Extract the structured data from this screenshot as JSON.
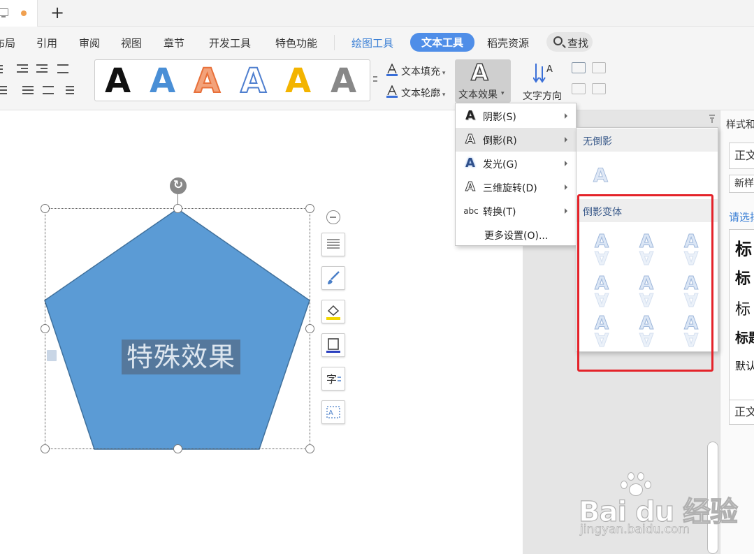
{
  "tabbar": {
    "new_tab": "+"
  },
  "menu": {
    "items": [
      "布局",
      "引用",
      "审阅",
      "视图",
      "章节",
      "开发工具",
      "特色功能"
    ],
    "drawing_tools": "绘图工具",
    "text_tools": "文本工具",
    "resources": "稻壳资源",
    "search": "查找"
  },
  "toolbar": {
    "style_glyph": "A",
    "text_fill": "文本填充",
    "text_outline": "文本轮廓",
    "text_effects": "文本效果",
    "text_direction": "文字方向",
    "gallery_colors": [
      "#111111",
      "#4a8fd6",
      "#f08c52",
      "#4f7fcf",
      "#f3b400",
      "#777777"
    ]
  },
  "effects_menu": {
    "items": [
      {
        "label": "阴影(S)",
        "icon": "shadow-a-icon",
        "has_sub": true
      },
      {
        "label": "倒影(R)",
        "icon": "reflection-a-icon",
        "has_sub": true
      },
      {
        "label": "发光(G)",
        "icon": "glow-a-icon",
        "has_sub": true
      },
      {
        "label": "三维旋转(D)",
        "icon": "3d-rotation-a-icon",
        "has_sub": true
      },
      {
        "label": "转换(T)",
        "icon": "abc-transform-icon",
        "has_sub": true
      },
      {
        "label": "更多设置(O)...",
        "icon": "",
        "has_sub": false
      }
    ],
    "abc": "abc"
  },
  "reflection_submenu": {
    "no_reflection": "无倒影",
    "variants_heading": "倒影变体"
  },
  "shape": {
    "text": "特殊效果",
    "fill_color": "#5b9bd5",
    "stroke_color": "#41719c"
  },
  "right_panel": {
    "title": "样式和",
    "body_text": "正文",
    "new_style": "新样",
    "select_prompt": "请选择",
    "list": [
      "标",
      "标",
      "标",
      "标题",
      "默认"
    ],
    "current": "正文"
  },
  "watermark": {
    "main": "Bai du 经验",
    "sub": "jingyan.baidu.com"
  },
  "highlight_color": "#e4232a"
}
